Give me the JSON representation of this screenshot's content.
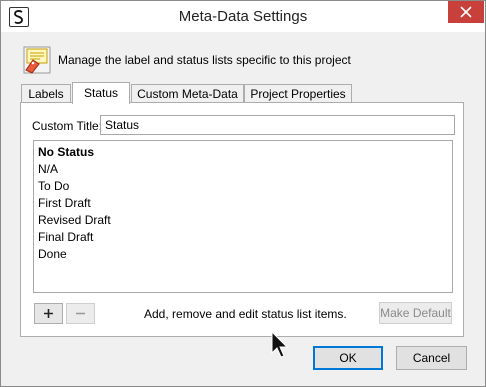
{
  "window": {
    "title": "Meta-Data Settings"
  },
  "header": {
    "description": "Manage the label and status lists specific to this project"
  },
  "tabs": [
    {
      "label": "Labels",
      "active": false
    },
    {
      "label": "Status",
      "active": true
    },
    {
      "label": "Custom Meta-Data",
      "active": false
    },
    {
      "label": "Project Properties",
      "active": false
    }
  ],
  "custom_title": {
    "label": "Custom Title:",
    "value": "Status"
  },
  "status_list": {
    "items": [
      "No Status",
      "N/A",
      "To Do",
      "First Draft",
      "Revised Draft",
      "Final Draft",
      "Done"
    ]
  },
  "list_controls": {
    "add_symbol": "+",
    "remove_symbol": "−",
    "hint": "Add, remove and edit status list items.",
    "make_default_label": "Make Default"
  },
  "buttons": {
    "ok": "OK",
    "cancel": "Cancel"
  },
  "colors": {
    "close_button": "#c7403a",
    "focus_border": "#0078d7"
  }
}
